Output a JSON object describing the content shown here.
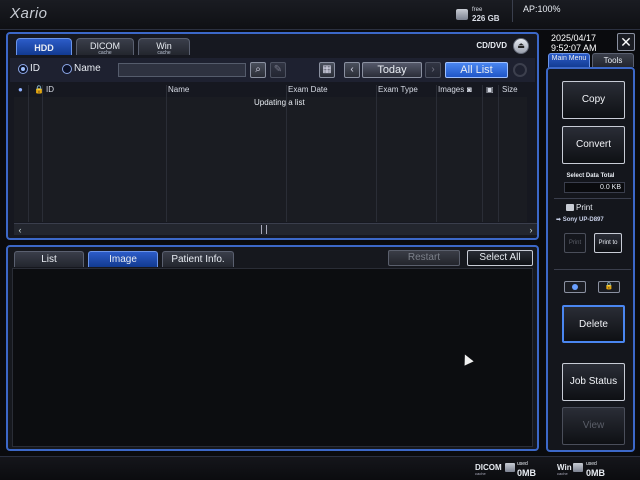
{
  "topbar": {
    "brand": "Xario",
    "free_label": "free",
    "free_value": "226 GB",
    "ap_status": "AP:100%"
  },
  "upper": {
    "tabs": [
      {
        "main": "HDD",
        "sub": ""
      },
      {
        "main": "DICOM",
        "sub": "cache"
      },
      {
        "main": "Win",
        "sub": "cache"
      }
    ],
    "cddvd_label": "CD/DVD",
    "search": {
      "radio_id": "ID",
      "radio_name": "Name",
      "input_value": "",
      "today_label": "Today",
      "all_list_label": "All List"
    },
    "table": {
      "columns": [
        "ID",
        "Name",
        "Exam Date",
        "Exam Type",
        "Images"
      ],
      "extra_column": "Size",
      "status_text": "Updating a list"
    }
  },
  "lower": {
    "tabs": [
      "List",
      "Image",
      "Patient Info."
    ],
    "restart_label": "Restart",
    "select_all_label": "Select All"
  },
  "sidebar": {
    "date": "2025/04/17",
    "time": "9:52:07 AM",
    "tab_main": "Main Menu",
    "tab_tools": "Tools",
    "copy_label": "Copy",
    "convert_label": "Convert",
    "select_total_label": "Select Data Total",
    "select_total_value": "0.0 KB",
    "print_label": "Print",
    "printer_name": "Sony UP-D897",
    "print_btn_label": "Print",
    "print_to_label": "Print to",
    "delete_label": "Delete",
    "job_status_label": "Job Status",
    "view_label": "View"
  },
  "bottombar": {
    "dicom_name": "DICOM",
    "dicom_sub": "cache",
    "dicom_used_label": "used",
    "dicom_used_value": "0MB",
    "win_name": "Win",
    "win_sub": "cache",
    "win_used_label": "used",
    "win_used_value": "0MB"
  },
  "colors": {
    "accent_blue": "#3c68c8",
    "active_tab": "#2c5cc8",
    "background": "#0a0b0e"
  }
}
